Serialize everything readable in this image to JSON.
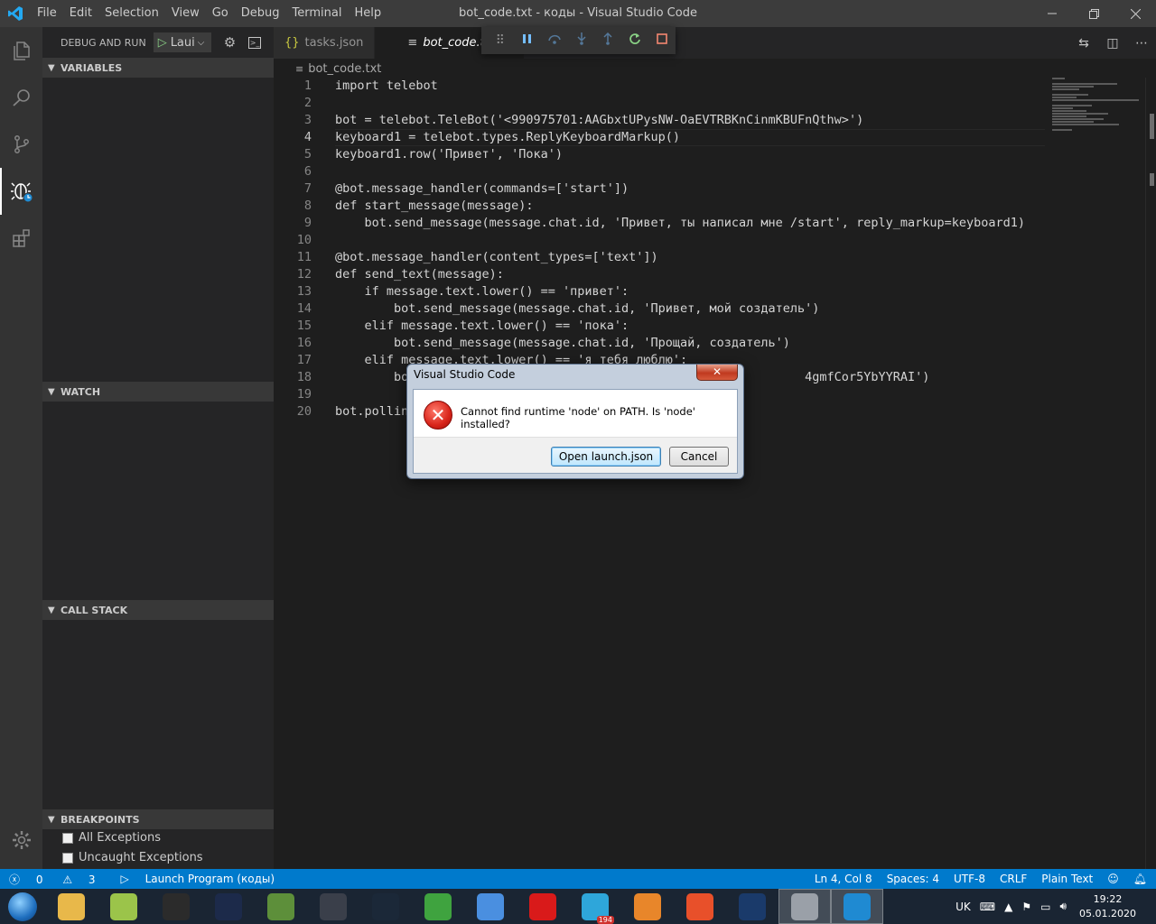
{
  "window": {
    "title": "bot_code.txt - коды - Visual Studio Code",
    "menu": [
      "File",
      "Edit",
      "Selection",
      "View",
      "Go",
      "Debug",
      "Terminal",
      "Help"
    ]
  },
  "sidebar": {
    "header": "DEBUG AND RUN",
    "launch_config": "Laui",
    "sections": {
      "variables": "VARIABLES",
      "watch": "WATCH",
      "call_stack": "CALL STACK",
      "breakpoints": "BREAKPOINTS"
    },
    "breakpoints": [
      {
        "label": "All Exceptions",
        "checked": false
      },
      {
        "label": "Uncaught Exceptions",
        "checked": false
      }
    ]
  },
  "tabs": [
    {
      "label": "tasks.json",
      "icon": "json-braces-icon",
      "active": false
    },
    {
      "label": "bot_code.txt",
      "icon": "text-file-icon",
      "active": true
    }
  ],
  "breadcrumb": "bot_code.txt",
  "editor": {
    "current_line": 4,
    "lines": [
      {
        "n": "1",
        "text": "import telebot"
      },
      {
        "n": "2",
        "text": ""
      },
      {
        "n": "3",
        "text": "bot = telebot.TeleBot('<990975701:AAGbxtUPysNW-OaEVTRBKnCinmKBUFnQthw>')"
      },
      {
        "n": "4",
        "text": "keyboard1 = telebot.types.ReplyKeyboardMarkup()"
      },
      {
        "n": "5",
        "text": "keyboard1.row('Привет', 'Пока')"
      },
      {
        "n": "6",
        "text": ""
      },
      {
        "n": "7",
        "text": "@bot.message_handler(commands=['start'])"
      },
      {
        "n": "8",
        "text": "def start_message(message):"
      },
      {
        "n": "9",
        "text": "    bot.send_message(message.chat.id, 'Привет, ты написал мне /start', reply_markup=keyboard1)"
      },
      {
        "n": "10",
        "text": ""
      },
      {
        "n": "11",
        "text": "@bot.message_handler(content_types=['text'])"
      },
      {
        "n": "12",
        "text": "def send_text(message):"
      },
      {
        "n": "13",
        "text": "    if message.text.lower() == 'привет':"
      },
      {
        "n": "14",
        "text": "        bot.send_message(message.chat.id, 'Привет, мой создатель')"
      },
      {
        "n": "15",
        "text": "    elif message.text.lower() == 'пока':"
      },
      {
        "n": "16",
        "text": "        bot.send_message(message.chat.id, 'Прощай, создатель')"
      },
      {
        "n": "17",
        "text": "    elif message.text.lower() == 'я тебя люблю':"
      },
      {
        "n": "18",
        "text": "        bot                                                     4gmfCor5YbYYRAI')"
      },
      {
        "n": "19",
        "text": ""
      },
      {
        "n": "20",
        "text": "bot.pollin"
      }
    ]
  },
  "debug_toolbar": {
    "icons": [
      "drag-grip-icon",
      "pause-icon",
      "step-over-icon",
      "step-into-icon",
      "step-out-icon",
      "restart-icon",
      "stop-icon"
    ],
    "colors": {
      "pause": "#75beff",
      "step": "#75beff",
      "restart": "#89d185",
      "stop": "#f48771"
    }
  },
  "dialog": {
    "title": "Visual Studio Code",
    "close_label": "✕",
    "message": "Cannot find runtime 'node' on PATH. Is 'node' installed?",
    "primary_button": "Open launch.json",
    "secondary_button": "Cancel"
  },
  "statusbar": {
    "errors": "0",
    "warnings": "3",
    "launch": "Launch Program (коды)",
    "position": "Ln 4, Col 8",
    "spaces": "Spaces: 4",
    "encoding": "UTF-8",
    "eol": "CRLF",
    "language": "Plain Text",
    "color": "#007acc"
  },
  "taskbar": {
    "language": "UK",
    "time": "19:22",
    "date": "05.01.2020",
    "telegram_badge": "194",
    "apps": [
      {
        "name": "file-explorer-icon",
        "color": "#e8b84a"
      },
      {
        "name": "notepad-plus-icon",
        "color": "#9bc44a"
      },
      {
        "name": "obs-icon",
        "color": "#2b2b2b"
      },
      {
        "name": "nt-app-icon",
        "color": "#1c2a4a"
      },
      {
        "name": "minecraft-icon",
        "color": "#5d8f3a"
      },
      {
        "name": "nox-player-icon",
        "color": "#3a3f4a"
      },
      {
        "name": "steam-icon",
        "color": "#1b2838"
      },
      {
        "name": "utorrent-icon",
        "color": "#3fa33f"
      },
      {
        "name": "chrome-icon",
        "color": "#4a8fe0"
      },
      {
        "name": "opera-icon",
        "color": "#d91a1a"
      },
      {
        "name": "telegram-icon",
        "color": "#2ea6da"
      },
      {
        "name": "fl-studio-icon",
        "color": "#e8862a"
      },
      {
        "name": "audio-app-icon",
        "color": "#e8502a"
      },
      {
        "name": "media-player-icon",
        "color": "#1a3a6a"
      },
      {
        "name": "settings-app-icon",
        "color": "#9aa0a8"
      },
      {
        "name": "vscode-icon",
        "color": "#1f8ad2"
      }
    ]
  }
}
